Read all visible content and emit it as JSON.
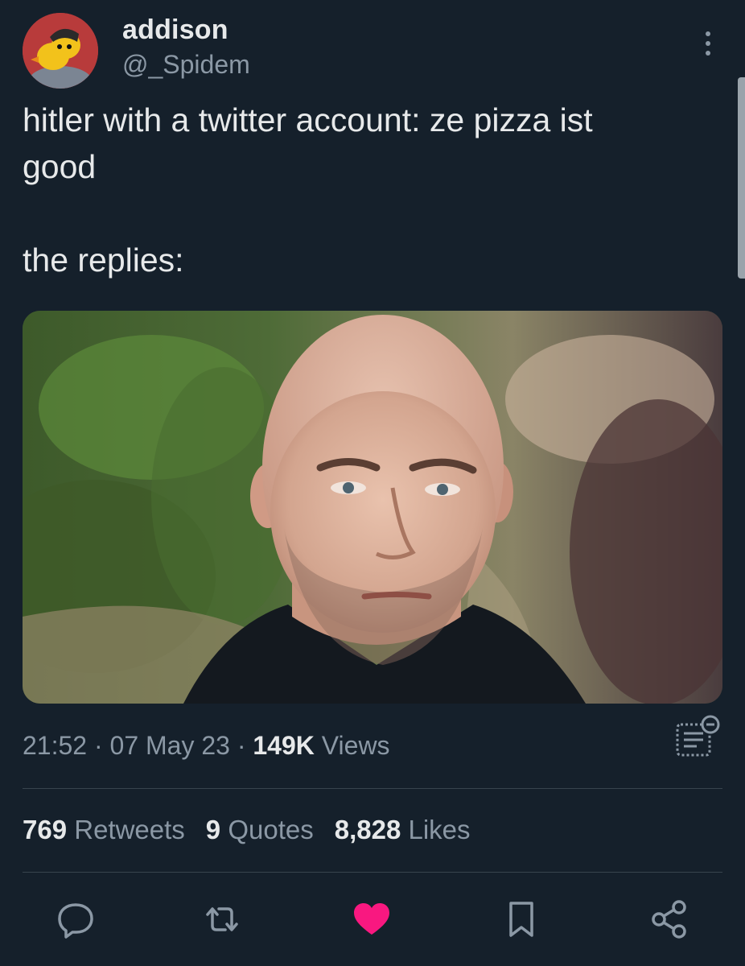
{
  "user": {
    "display_name": "addison",
    "handle": "@_Spidem"
  },
  "tweet": {
    "text": "hitler with a twitter account: ze pizza ist\ngood\n\nthe replies:",
    "time": "21:52",
    "separator": " · ",
    "date": "07 May 23",
    "views_count": "149K",
    "views_label": " Views"
  },
  "stats": {
    "retweets_count": "769",
    "retweets_label": " Retweets",
    "quotes_count": "9",
    "quotes_label": " Quotes",
    "likes_count": "8,828",
    "likes_label": " Likes"
  },
  "actions": [
    {
      "icon": "reply-icon"
    },
    {
      "icon": "retweet-icon"
    },
    {
      "icon": "like-icon",
      "active": true,
      "color": "#f91880"
    },
    {
      "icon": "bookmark-icon"
    },
    {
      "icon": "share-icon"
    }
  ],
  "colors": {
    "background": "#15202b",
    "text_primary": "#e7e9ea",
    "text_secondary": "#8b98a5",
    "like_active": "#f91880",
    "divider": "#38444d"
  }
}
